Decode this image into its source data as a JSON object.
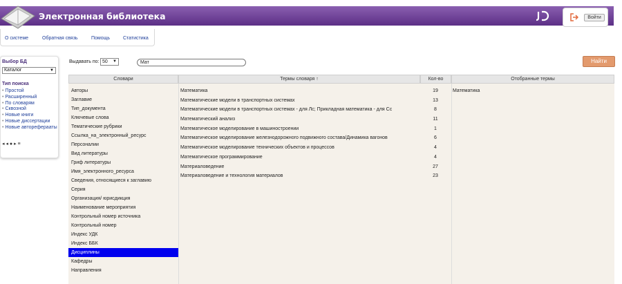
{
  "header": {
    "title": "Электронная библиотека",
    "login_label": "Войти"
  },
  "menu": [
    "О системе",
    "Обратная связь",
    "Помощь",
    "Статистика"
  ],
  "sidebar": {
    "db_title": "Выбор БД",
    "db_value": "Каталог",
    "search_type_title": "Тип поиска",
    "search_types": [
      "Простой",
      "Расширенный",
      "По словарям",
      "Сквозной",
      "Новые книги",
      "Новые диссертации",
      "Новые автореферааты"
    ],
    "nav": "◂   ◂   ●   ▸   ≡"
  },
  "search": {
    "per_page_label": "Выдавать по:",
    "per_page_value": "50",
    "query": "Мат",
    "find_label": "Найти"
  },
  "table": {
    "headers": {
      "dicts": "Словари",
      "terms": "Термы словаря ↑",
      "count": "Кол-во",
      "selected": "Отобранные термы"
    },
    "dictionaries": [
      "Авторы",
      "Заглавие",
      "Тип_документа",
      "Ключевые слова",
      "Тематические рубрики",
      "Ссылка_на_электронный_ресурс",
      "Персоналии",
      "Вид литературы",
      "Гриф литературы",
      "Имя_электронного_ресурса",
      "Сведения, относящиеся к заглавию",
      "Серия",
      "Организация/ юрисдикция",
      "Наименование мероприятия",
      "Контрольный номер источника",
      "Контрольный номер",
      "Индекс УДК",
      "Индекс ББК",
      "Дисциплины",
      "Кафедры",
      "Направления"
    ],
    "selected_dictionary": "Дисциплины",
    "terms": [
      {
        "text": "Математика",
        "count": "19"
      },
      {
        "text": "Математические модели в транспортных системах",
        "count": "13"
      },
      {
        "text": "Математические модели в транспортных системах - для Лс; Прикладная математика - для Сс",
        "count": "8"
      },
      {
        "text": "Математический анализ",
        "count": "11"
      },
      {
        "text": "Математическое моделирование в машиностроении",
        "count": "1"
      },
      {
        "text": "Математическое моделирование железнодорожного подвижного состава/Динамика вагонов",
        "count": "6"
      },
      {
        "text": "Математическое моделирование технических объектов и процессов",
        "count": "4"
      },
      {
        "text": "Математическое программирование",
        "count": "4"
      },
      {
        "text": "Материаловедение",
        "count": "27"
      },
      {
        "text": "Материаловедение и технология материалов",
        "count": "23"
      }
    ],
    "selected_terms": [
      "Математика"
    ]
  },
  "colors": {
    "header_top": "#8a5fb0",
    "header_bottom": "#5c2f86",
    "selected_row": "#0000ee",
    "find_button": "#e39a6d"
  }
}
